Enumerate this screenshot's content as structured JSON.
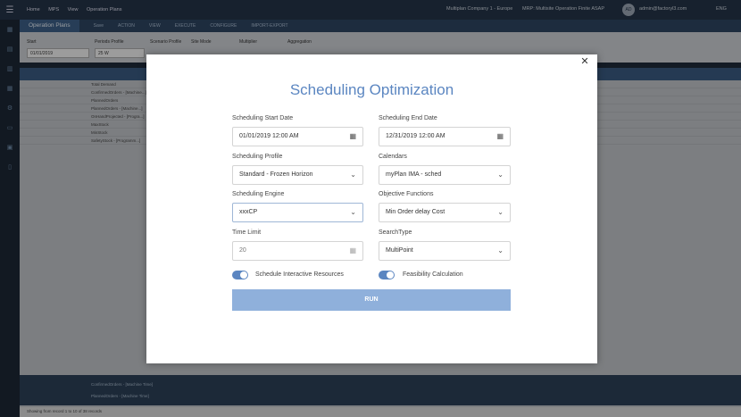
{
  "topbar": {
    "breadcrumb": [
      "Home",
      "MPS",
      "View",
      "Operation Plans"
    ],
    "company": "Multiplan Company 1 - Europe",
    "mrp": "MRP: Multisite Operation Finite ASAP",
    "avatar": "AD",
    "user": "admin@factoryl3.com",
    "lang": "ENG"
  },
  "tabsbar": {
    "title": "Operation Plans",
    "tabs": [
      "Save",
      "ACTION",
      "VIEW",
      "EXECUTE",
      "CONFIGURE",
      "IMPORT-EXPORT"
    ]
  },
  "filters": {
    "start_label": "Start",
    "start_value": "01/01/2019",
    "periods_label": "Periods Profile",
    "periods_value": "25 W",
    "scenario_label": "Scenario Profile",
    "site_label": "Site Mode",
    "multiplier_label": "Multiplier",
    "aggregation_label": "Aggregation"
  },
  "grid": {
    "rows": [
      "Total Demand",
      "ConfirmedOrders - [Machine...]",
      "PlannedOrders",
      "PlannedOrders - [Machine...]",
      "OnHandProjected - [Progra...]",
      "MaxStock",
      "MinStock",
      "SafetyStock - [Programm...]"
    ],
    "footer_rows": [
      "ConfirmedOrders - [Machine Time]",
      "PlannedOrders - [Machine Time]"
    ],
    "status": "Showing from record 1 to 10 of 38 records"
  },
  "modal": {
    "title": "Scheduling Optimization",
    "start_date_label": "Scheduling Start Date",
    "start_date_value": "01/01/2019 12:00 AM",
    "end_date_label": "Scheduling End Date",
    "end_date_value": "12/31/2019 12:00 AM",
    "profile_label": "Scheduling Profile",
    "profile_value": "Standard - Frozen Horizon",
    "calendars_label": "Calendars",
    "calendars_value": "myPlan IMA - sched",
    "engine_label": "Scheduling Engine",
    "engine_value": "xxxCP",
    "objective_label": "Objective Functions",
    "objective_value": "Min Order delay Cost",
    "time_limit_label": "Time Limit",
    "time_limit_value": "20",
    "search_type_label": "SearchType",
    "search_type_value": "MultiPoint",
    "toggle_interactive_label": "Schedule Interactive Resources",
    "toggle_feasibility_label": "Feasibility Calculation",
    "run_label": "RUN"
  }
}
